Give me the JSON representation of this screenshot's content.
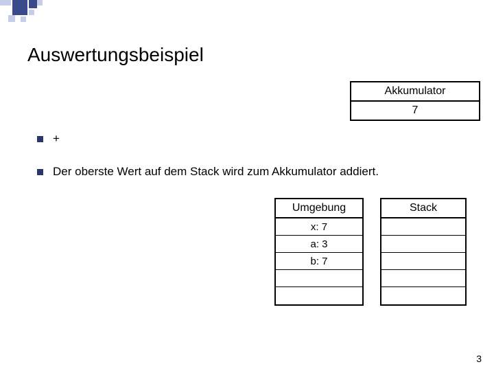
{
  "title": "Auswertungsbeispiel",
  "accumulator": {
    "header": "Akkumulator",
    "value": "7"
  },
  "bullets": [
    {
      "text": "+"
    },
    {
      "text": "Der oberste Wert auf dem Stack wird zum Akkumulator addiert."
    }
  ],
  "env": {
    "header": "Umgebung",
    "rows": [
      "x: 7",
      "a: 3",
      "b: 7",
      "",
      ""
    ]
  },
  "stack": {
    "header": "Stack",
    "rows": [
      "",
      "",
      "",
      "",
      ""
    ]
  },
  "page_number": "3"
}
